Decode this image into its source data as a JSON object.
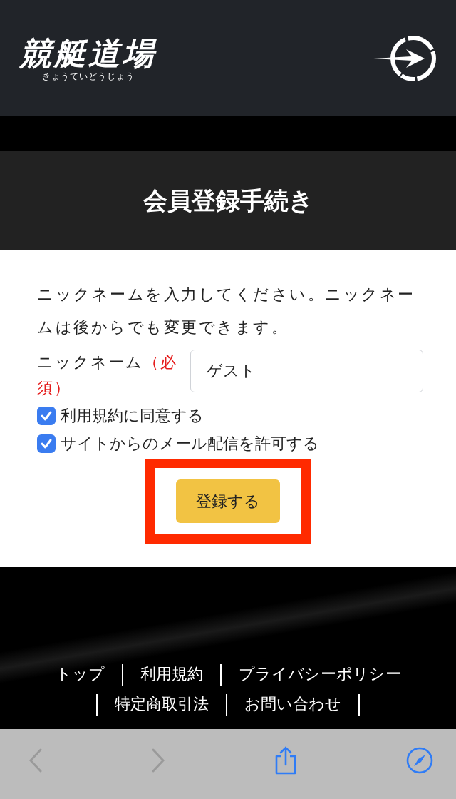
{
  "header": {
    "logo": {
      "title": "競艇道場",
      "reading": "きょうていどうじょう"
    }
  },
  "page_title": "会員登録手続き",
  "form": {
    "intro": "ニックネームを入力してください。ニックネームは後からでも変更できます。",
    "nickname": {
      "label": "ニックネーム",
      "required": "（必須）",
      "value": "ゲスト"
    },
    "checkboxes": [
      {
        "label": "利用規約に同意する",
        "checked": true
      },
      {
        "label": "サイトからのメール配信を許可する",
        "checked": true
      }
    ],
    "submit": {
      "label": "登録する",
      "highlighted": true
    }
  },
  "footer_links": [
    "トップ",
    "利用規約",
    "プライバシーポリシー",
    "特定商取引法",
    "お問い合わせ"
  ],
  "browser_toolbar": [
    {
      "kind": "back",
      "disabled": true
    },
    {
      "kind": "forward",
      "disabled": true
    },
    {
      "kind": "share",
      "disabled": false
    },
    {
      "kind": "compass",
      "disabled": false
    }
  ]
}
